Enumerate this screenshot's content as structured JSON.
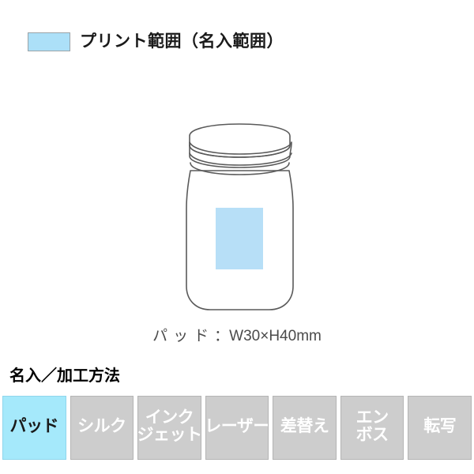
{
  "legend": {
    "swatch_color": "#ace0f8",
    "swatch_border": "#9aa3a8",
    "label": "プリント範囲（名入範囲）"
  },
  "illustration": {
    "product": "mason-jar",
    "outline_color": "#5a5a5a",
    "print_area": {
      "fill_color": "#b7dff7",
      "width_mm": 30,
      "height_mm": 40
    }
  },
  "caption": {
    "method": "パッド",
    "separator": "：",
    "dimensions": "W30×H40mm"
  },
  "section": {
    "heading": "名入／加工方法"
  },
  "methods": {
    "active_color": "#a5e9fb",
    "inactive_color": "#cdcdcd",
    "items": [
      {
        "lines": [
          "パッド"
        ],
        "active": true
      },
      {
        "lines": [
          "シルク"
        ],
        "active": false
      },
      {
        "lines": [
          "インク",
          "ジェット"
        ],
        "active": false
      },
      {
        "lines": [
          "レーザー"
        ],
        "active": false
      },
      {
        "lines": [
          "差替え"
        ],
        "active": false
      },
      {
        "lines": [
          "エン",
          "ボス"
        ],
        "active": false
      },
      {
        "lines": [
          "転写"
        ],
        "active": false
      }
    ]
  }
}
